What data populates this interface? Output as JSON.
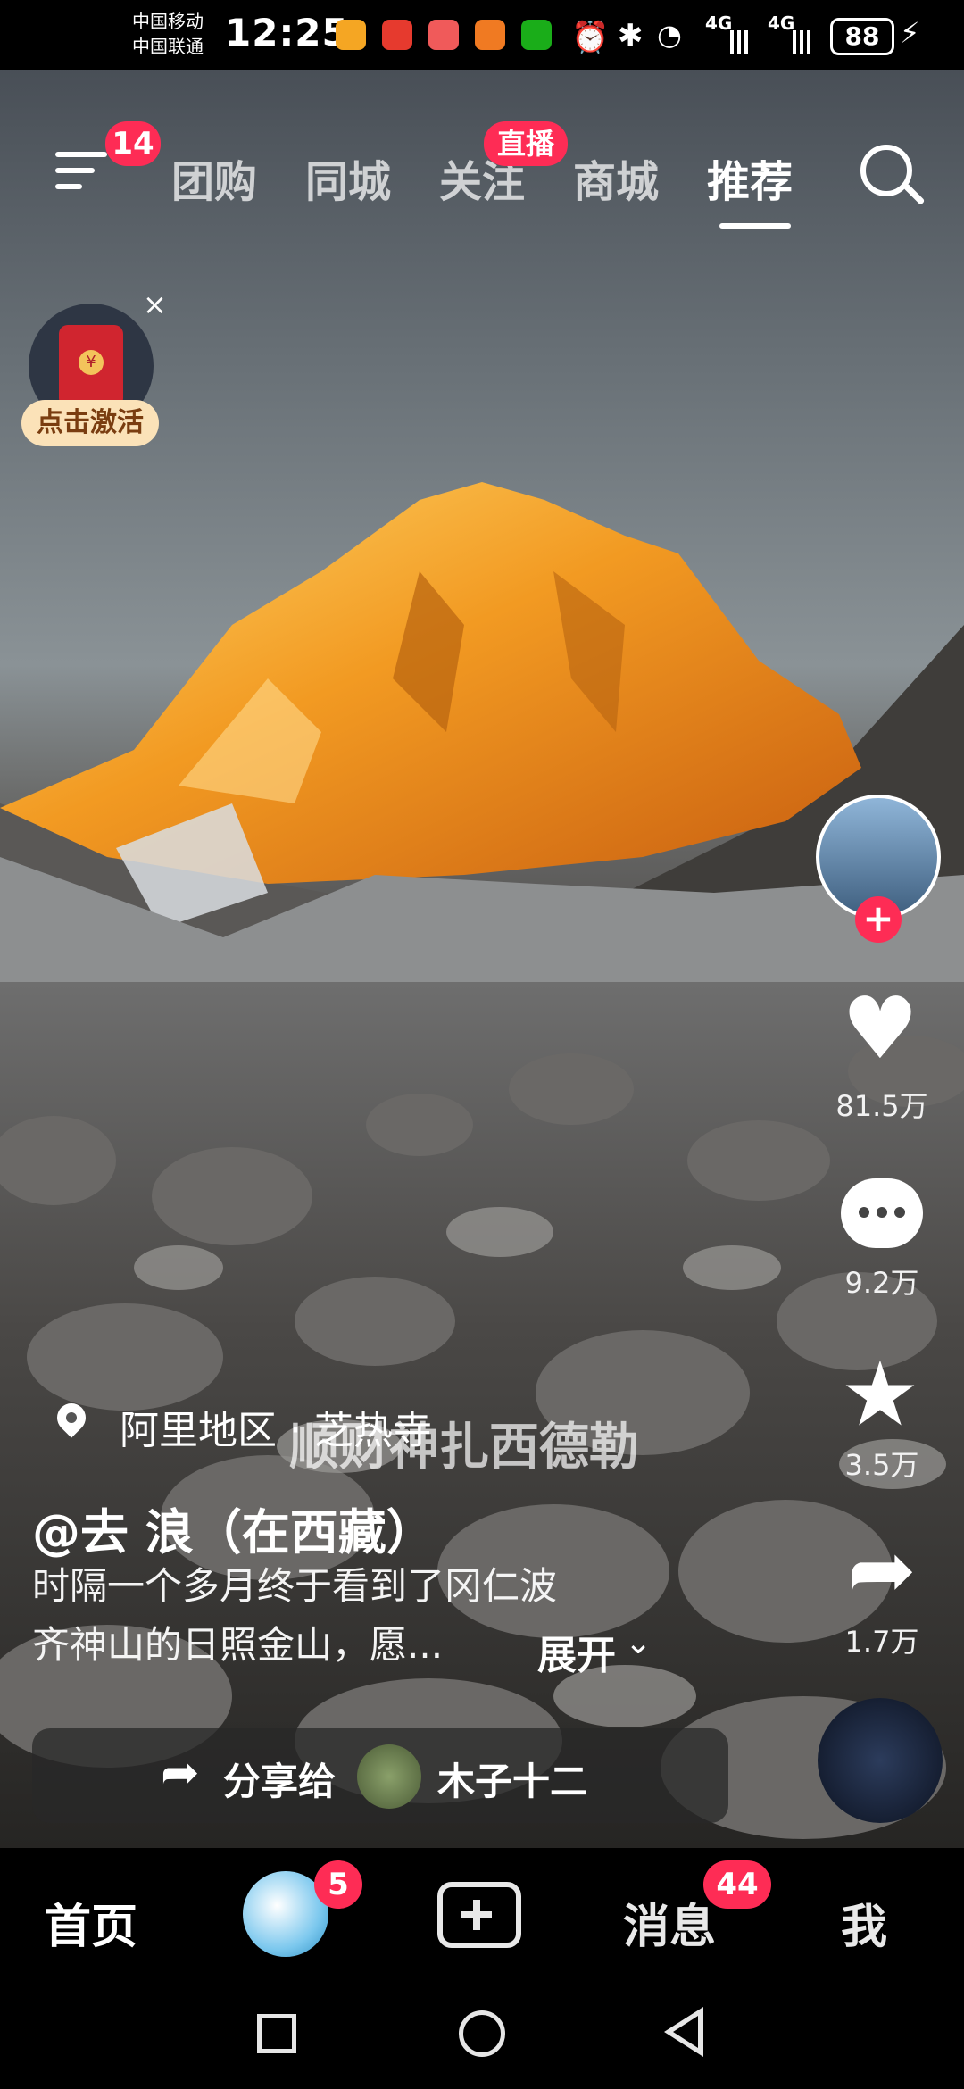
{
  "status_bar": {
    "carrier_1": "中国移动",
    "carrier_2": "中国联通",
    "time": "12:25",
    "net_1": "4G",
    "net_2": "4G",
    "battery": "88"
  },
  "top_nav": {
    "menu_badge": "14",
    "tabs": [
      "团购",
      "同城",
      "关注",
      "商城",
      "推荐"
    ],
    "live_badge": "直播",
    "active_tab": "推荐"
  },
  "redpacket": {
    "label": "点击激活",
    "close": "×"
  },
  "video": {
    "location": "阿里地区 · 芝热寺",
    "overlay_caption": "顺财神扎西德勒",
    "author": "@去 浪（在西藏）",
    "desc_line1": "时隔一个多月终于看到了冈仁波",
    "desc_line2": "齐神山的日照金山，愿...",
    "expand": "展开"
  },
  "actions": {
    "likes": "81.5万",
    "comments": "9.2万",
    "favorites": "3.5万",
    "shares": "1.7万"
  },
  "share_bar": {
    "label": "分享给",
    "friend": "木子十二"
  },
  "bottom_nav": {
    "home": "首页",
    "friends_badge": "5",
    "messages": "消息",
    "messages_badge": "44",
    "me": "我"
  },
  "colors": {
    "accent": "#fe2c55",
    "peak_gold": "#f5a623"
  }
}
